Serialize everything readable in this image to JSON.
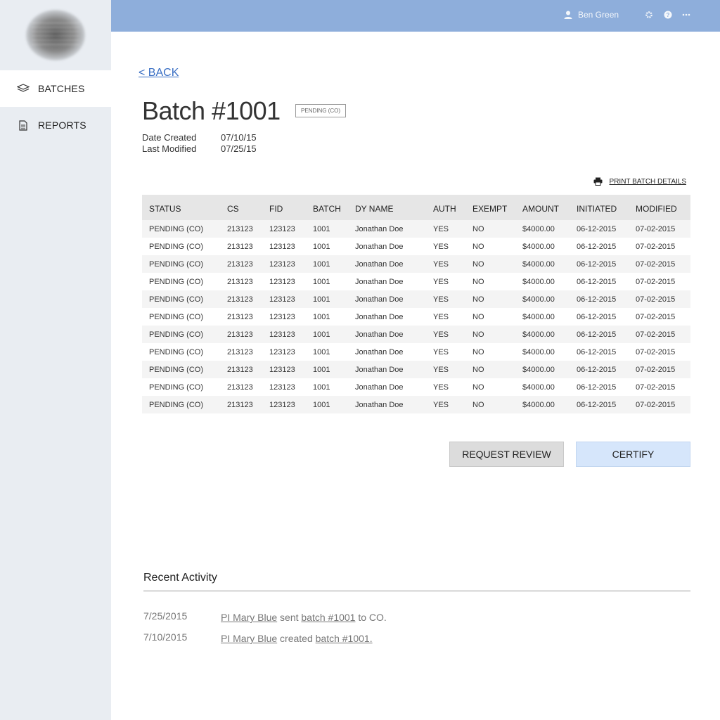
{
  "sidebar": {
    "items": [
      {
        "label": "BATCHES",
        "icon": "layers-icon",
        "active": true
      },
      {
        "label": "REPORTS",
        "icon": "document-icon",
        "active": false
      }
    ]
  },
  "topbar": {
    "user_name": "Ben Green",
    "icons": [
      "user-icon",
      "gear-icon",
      "help-icon",
      "more-icon"
    ],
    "color": "#8eaedb"
  },
  "page": {
    "back_label": "< BACK",
    "title": "Batch #1001",
    "status_badge": "PENDING (CO)",
    "meta": [
      {
        "key": "Date Created",
        "value": "07/10/15"
      },
      {
        "key": "Last Modified",
        "value": "07/25/15"
      }
    ],
    "print_label": "PRINT BATCH DETAILS"
  },
  "table": {
    "columns": [
      "STATUS",
      "CS",
      "FID",
      "BATCH",
      "DY NAME",
      "AUTH",
      "EXEMPT",
      "AMOUNT",
      "INITIATED",
      "MODIFIED"
    ],
    "rows": [
      [
        "PENDING (CO)",
        "213123",
        "123123",
        "1001",
        "Jonathan Doe",
        "YES",
        "NO",
        "$4000.00",
        "06-12-2015",
        "07-02-2015"
      ],
      [
        "PENDING (CO)",
        "213123",
        "123123",
        "1001",
        "Jonathan Doe",
        "YES",
        "NO",
        "$4000.00",
        "06-12-2015",
        "07-02-2015"
      ],
      [
        "PENDING (CO)",
        "213123",
        "123123",
        "1001",
        "Jonathan Doe",
        "YES",
        "NO",
        "$4000.00",
        "06-12-2015",
        "07-02-2015"
      ],
      [
        "PENDING (CO)",
        "213123",
        "123123",
        "1001",
        "Jonathan Doe",
        "YES",
        "NO",
        "$4000.00",
        "06-12-2015",
        "07-02-2015"
      ],
      [
        "PENDING (CO)",
        "213123",
        "123123",
        "1001",
        "Jonathan Doe",
        "YES",
        "NO",
        "$4000.00",
        "06-12-2015",
        "07-02-2015"
      ],
      [
        "PENDING (CO)",
        "213123",
        "123123",
        "1001",
        "Jonathan Doe",
        "YES",
        "NO",
        "$4000.00",
        "06-12-2015",
        "07-02-2015"
      ],
      [
        "PENDING (CO)",
        "213123",
        "123123",
        "1001",
        "Jonathan Doe",
        "YES",
        "NO",
        "$4000.00",
        "06-12-2015",
        "07-02-2015"
      ],
      [
        "PENDING (CO)",
        "213123",
        "123123",
        "1001",
        "Jonathan Doe",
        "YES",
        "NO",
        "$4000.00",
        "06-12-2015",
        "07-02-2015"
      ],
      [
        "PENDING (CO)",
        "213123",
        "123123",
        "1001",
        "Jonathan Doe",
        "YES",
        "NO",
        "$4000.00",
        "06-12-2015",
        "07-02-2015"
      ],
      [
        "PENDING (CO)",
        "213123",
        "123123",
        "1001",
        "Jonathan Doe",
        "YES",
        "NO",
        "$4000.00",
        "06-12-2015",
        "07-02-2015"
      ],
      [
        "PENDING (CO)",
        "213123",
        "123123",
        "1001",
        "Jonathan Doe",
        "YES",
        "NO",
        "$4000.00",
        "06-12-2015",
        "07-02-2015"
      ]
    ]
  },
  "actions": {
    "request_review_label": "REQUEST REVIEW",
    "certify_label": "CERTIFY"
  },
  "activity": {
    "title": "Recent Activity",
    "items": [
      {
        "date": "7/25/2015",
        "actor": "PI Mary Blue",
        "verb": " sent ",
        "object": "batch #1001",
        "suffix": " to CO."
      },
      {
        "date": "7/10/2015",
        "actor": "PI Mary Blue",
        "verb": " created ",
        "object": "batch #1001.",
        "suffix": ""
      }
    ]
  }
}
